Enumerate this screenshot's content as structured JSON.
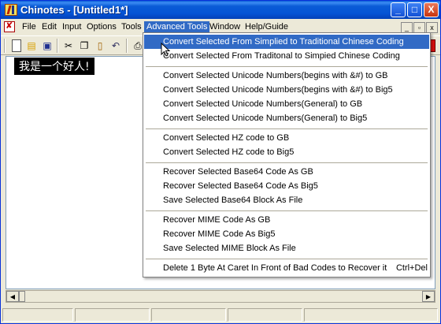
{
  "window": {
    "title": "Chinotes - [Untitled1*]",
    "controls": {
      "minimize": "_",
      "maximize": "□",
      "close": "X"
    }
  },
  "menubar": {
    "items": [
      "File",
      "Edit",
      "Input",
      "Options",
      "Tools",
      "Advanced Tools",
      "Window",
      "Help/Guide"
    ],
    "active": "Advanced Tools",
    "mdi": {
      "minimize": "_",
      "restore": "▫",
      "close": "x"
    }
  },
  "toolbar": {
    "icons": [
      "new-file-icon",
      "open-folder-icon",
      "save-icon",
      "cut-icon",
      "copy-icon",
      "paste-icon",
      "undo-icon",
      "print-icon"
    ]
  },
  "editor": {
    "selected_text": "我是一个好人!"
  },
  "dropdown": {
    "items": [
      "Convert Selected From Simplied to Traditional Chinese Coding",
      "Convert Selected From Traditonal to Simpied Chinese Coding",
      "Convert Selected Unicode Numbers(begins with &#) to GB",
      "Convert Selected Unicode Numbers(begins with &#) to Big5",
      "Convert Selected Unicode Numbers(General) to GB",
      "Convert Selected Unicode Numbers(General) to Big5",
      "Convert Selected HZ code to GB",
      "Convert Selected HZ code to Big5",
      "Recover Selected Base64 Code As GB",
      "Recover Selected Base64 Code As Big5",
      "Save Selected Base64 Block As File",
      "Recover MIME Code As GB",
      "Recover MIME Code As Big5",
      "Save Selected MIME Block As File",
      "Delete 1 Byte At Caret In Front of Bad Codes to Recover it"
    ],
    "last_shortcut": "Ctrl+Del",
    "highlighted_index": 0
  },
  "colors": {
    "titlebar": "#0a5bd6",
    "highlight": "#316ac5",
    "face": "#ece9d8"
  }
}
